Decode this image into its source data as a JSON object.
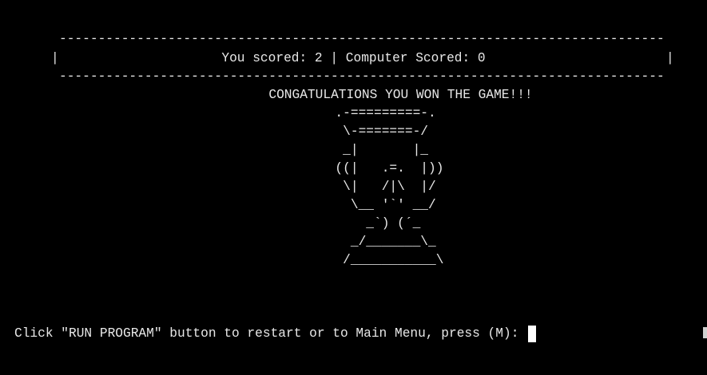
{
  "terminal": {
    "rule_top": "-------------------------------------------------------------------------------------",
    "rule_bottom": "-------------------------------------------------------------------------------------",
    "left_pipe": "|",
    "right_pipe": "|",
    "score_line": "You scored: 2 | Computer Scored: 0",
    "message": "CONGATULATIONS YOU WON THE GAME!!!",
    "trophy_art": "  .-=========-.\n   \\-=======-/\n   _|       |_\n  ((|   .=.  |))\n   \\|   /|\\  |/\n    \\__ '`' __/\n      _`) (´_\n    _/_______\\_\n   /___________\\",
    "prompt": "Click \"RUN PROGRAM\" button to restart or to Main Menu, press (M): "
  },
  "colors": {
    "background": "#000000",
    "text": "#e8e8e8",
    "cursor": "#ffffff"
  }
}
